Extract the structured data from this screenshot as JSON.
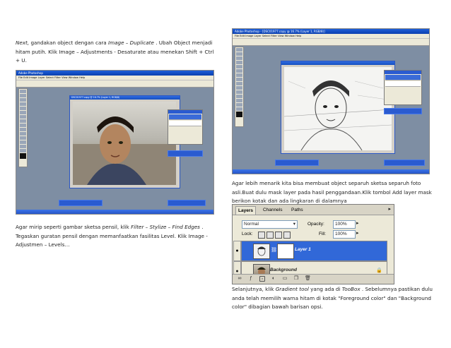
{
  "paragraphs": {
    "p1": {
      "prefix_italic": "Next,",
      "text_a": " gandakan object dengan cara ",
      "italic_a": "Image – Duplicate",
      "text_b": " . Ubah Object menjadi hitam putih. Klik Image – Adjustments - Desaturate atau  menekan Shift + Ctrl + U."
    },
    "p2": {
      "text_a": "Agar mirip seperti gambar sketsa pensil, klik ",
      "italic_a": "Filter – Stylize – Find Edges",
      "text_b": " . Tegaskan guratan pensil dengan memanfaatkan fasilitas Level. Klik Image - Adjustmen – Levels…"
    },
    "p3": {
      "text": "Agar lebih menarik kita bisa membuat object separuh sketsa separuh foto asli.Buat dulu mask layer pada hasil penggandaan.Klik tombol Add layer mask berikon kotak dan ada lingkaran di dalamnya"
    },
    "p4": {
      "text_a": "Selanjutnya, klik ",
      "italic_a": "Gradient tool",
      "text_b": " yang ada di ",
      "italic_b": "TooBox",
      "text_c": " . Sebelumnya pastikan dulu anda telah memilih warna hitam di kotak \"Foreground color\" dan \"Background color\" dibagian bawah barisan opsi."
    }
  },
  "screenshot1": {
    "window_title": "Adobe Photoshop",
    "doc_title": "DSC01977.copy @ 16.7% (Layer 1, RGB/8)",
    "menu": "File  Edit  Image  Layer  Select  Filter  View  Window  Help"
  },
  "screenshot2": {
    "window_title": "Adobe Photoshop - [DSC01977.copy @ 16.7% (Layer 1, RGB/8)]",
    "menu": "File  Edit  Image  Layer  Select  Filter  View  Window  Help"
  },
  "layers_panel": {
    "tabs": [
      "Layers",
      "Channels",
      "Paths"
    ],
    "blend_mode": "Normal",
    "opacity_label": "Opacity:",
    "opacity_value": "100%",
    "lock_label": "Lock:",
    "fill_label": "Fill:",
    "fill_value": "100%",
    "layers": [
      {
        "name": "Layer 1",
        "selected": true
      },
      {
        "name": "Background",
        "selected": false
      }
    ]
  },
  "colors": {
    "ps_blue": "#2a5bd0",
    "ps_panel": "#ece9d8",
    "ps_workspace": "#7e8ea3"
  }
}
